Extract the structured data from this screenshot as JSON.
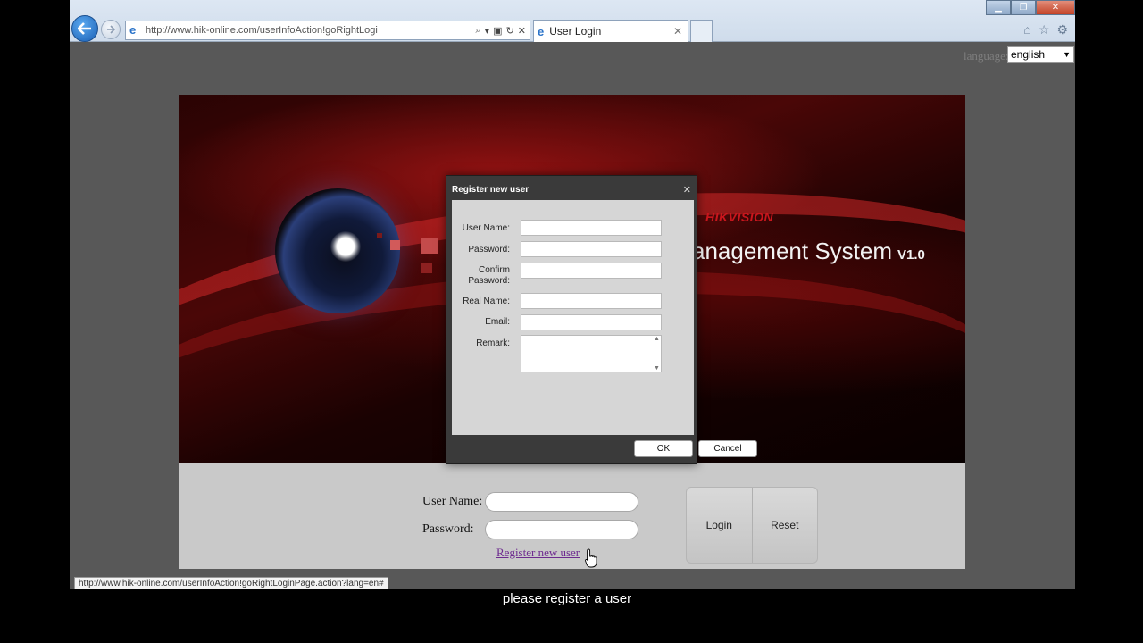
{
  "browser": {
    "url": "http://www.hik-online.com/userInfoAction!goRightLogi",
    "tab_title": "User Login",
    "status_url": "http://www.hik-online.com/userInfoAction!goRightLoginPage.action?lang=en#"
  },
  "language": {
    "label": "language:",
    "selected": "english"
  },
  "banner": {
    "brand": "HIKVISION",
    "title": "anagement System",
    "version": "V1.0"
  },
  "login": {
    "username_label": "User Name:",
    "password_label": "Password:",
    "register_link": "Register new user",
    "login_button": "Login",
    "reset_button": "Reset"
  },
  "modal": {
    "title": "Register new user",
    "fields": {
      "username": "User Name:",
      "password": "Password:",
      "confirm_1": "Confirm",
      "confirm_2": "Password:",
      "realname": "Real Name:",
      "email": "Email:",
      "remark": "Remark:"
    },
    "ok": "OK",
    "cancel": "Cancel"
  },
  "caption": "please register a user",
  "colors": {
    "accent_red": "#c9161d",
    "link_purple": "#6d2a8f"
  }
}
